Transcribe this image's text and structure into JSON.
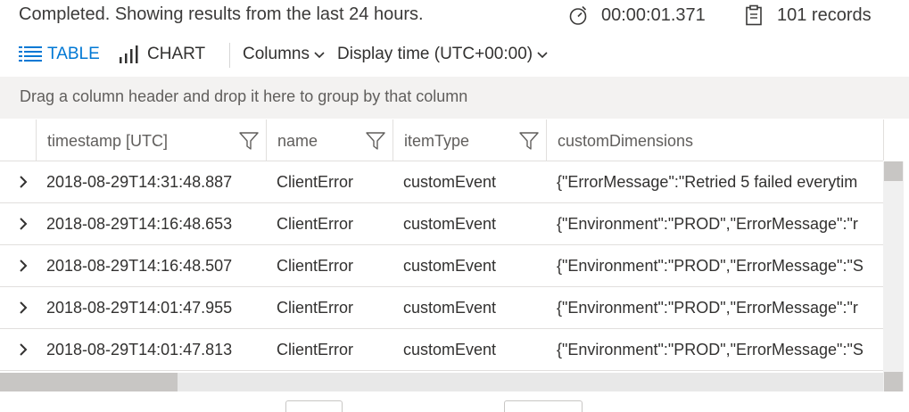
{
  "status": {
    "message": "Completed. Showing results from the last 24 hours.",
    "duration": "00:00:01.371",
    "records": "101 records",
    "icons": {
      "duration": "stopwatch-icon",
      "records": "clipboard-icon"
    }
  },
  "toolbar": {
    "table_label": "TABLE",
    "chart_label": "CHART",
    "columns_label": "Columns",
    "display_time_label": "Display time (UTC+00:00)",
    "accent_color": "#0078d4"
  },
  "group_panel": {
    "hint": "Drag a column header and drop it here to group by that column"
  },
  "grid": {
    "columns": [
      {
        "label": "timestamp [UTC]",
        "filterable": true
      },
      {
        "label": "name",
        "filterable": true
      },
      {
        "label": "itemType",
        "filterable": true
      },
      {
        "label": "customDimensions",
        "filterable": false
      }
    ],
    "rows": [
      {
        "timestamp": "2018-08-29T14:31:48.887",
        "name": "ClientError",
        "itemType": "customEvent",
        "customDimensions": "{\"ErrorMessage\":\"Retried 5 failed everytim"
      },
      {
        "timestamp": "2018-08-29T14:16:48.653",
        "name": "ClientError",
        "itemType": "customEvent",
        "customDimensions": "{\"Environment\":\"PROD\",\"ErrorMessage\":\"r"
      },
      {
        "timestamp": "2018-08-29T14:16:48.507",
        "name": "ClientError",
        "itemType": "customEvent",
        "customDimensions": "{\"Environment\":\"PROD\",\"ErrorMessage\":\"S"
      },
      {
        "timestamp": "2018-08-29T14:01:47.955",
        "name": "ClientError",
        "itemType": "customEvent",
        "customDimensions": "{\"Environment\":\"PROD\",\"ErrorMessage\":\"r"
      },
      {
        "timestamp": "2018-08-29T14:01:47.813",
        "name": "ClientError",
        "itemType": "customEvent",
        "customDimensions": "{\"Environment\":\"PROD\",\"ErrorMessage\":\"S"
      }
    ]
  }
}
